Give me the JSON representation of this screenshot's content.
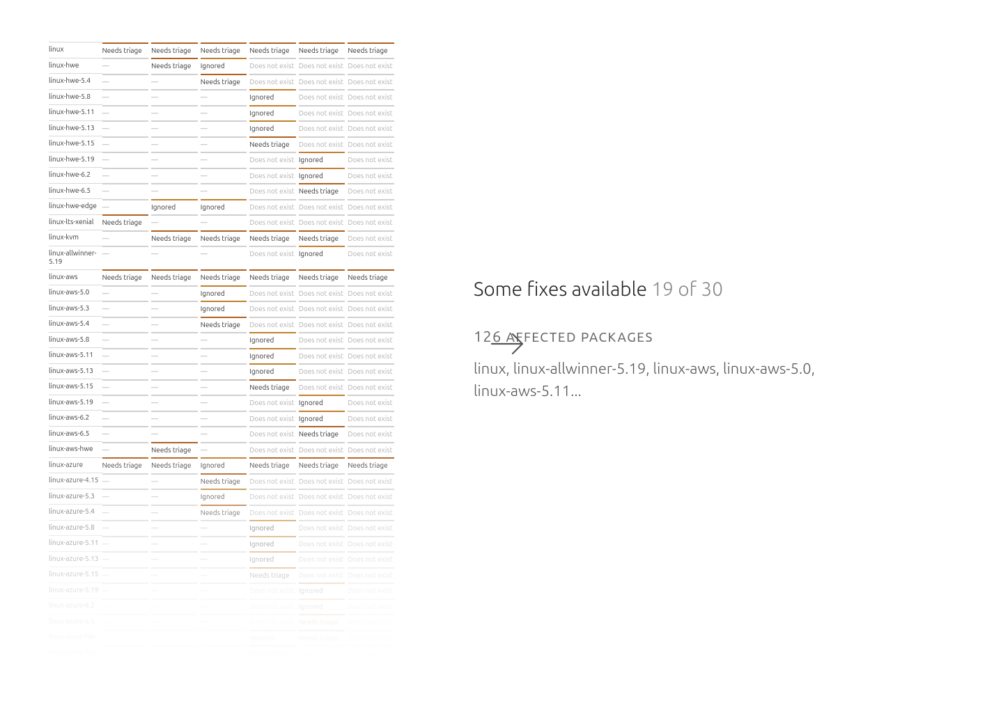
{
  "statuses": {
    "triage": "Needs triage",
    "ignored": "Ignored",
    "dne": "Does not exist",
    "dash": "—"
  },
  "table_rows": [
    {
      "pkg": "linux",
      "cells": [
        "triage",
        "triage",
        "triage",
        "triage",
        "triage",
        "triage"
      ]
    },
    {
      "pkg": "linux-hwe",
      "cells": [
        "dash",
        "triage",
        "ignored",
        "dne",
        "dne",
        "dne"
      ]
    },
    {
      "pkg": "linux-hwe-5.4",
      "cells": [
        "dash",
        "dash",
        "triage",
        "dne",
        "dne",
        "dne"
      ]
    },
    {
      "pkg": "linux-hwe-5.8",
      "cells": [
        "dash",
        "dash",
        "dash",
        "ignored",
        "dne",
        "dne"
      ]
    },
    {
      "pkg": "linux-hwe-5.11",
      "cells": [
        "dash",
        "dash",
        "dash",
        "ignored",
        "dne",
        "dne"
      ]
    },
    {
      "pkg": "linux-hwe-5.13",
      "cells": [
        "dash",
        "dash",
        "dash",
        "ignored",
        "dne",
        "dne"
      ]
    },
    {
      "pkg": "linux-hwe-5.15",
      "cells": [
        "dash",
        "dash",
        "dash",
        "triage",
        "dne",
        "dne"
      ]
    },
    {
      "pkg": "linux-hwe-5.19",
      "cells": [
        "dash",
        "dash",
        "dash",
        "dne",
        "ignored",
        "dne"
      ]
    },
    {
      "pkg": "linux-hwe-6.2",
      "cells": [
        "dash",
        "dash",
        "dash",
        "dne",
        "ignored",
        "dne"
      ]
    },
    {
      "pkg": "linux-hwe-6.5",
      "cells": [
        "dash",
        "dash",
        "dash",
        "dne",
        "triage",
        "dne"
      ]
    },
    {
      "pkg": "linux-hwe-edge",
      "cells": [
        "dash",
        "ignored",
        "ignored",
        "dne",
        "dne",
        "dne"
      ]
    },
    {
      "pkg": "linux-lts-xenial",
      "cells": [
        "triage",
        "dash",
        "dash",
        "dne",
        "dne",
        "dne"
      ]
    },
    {
      "pkg": "linux-kvm",
      "cells": [
        "dash",
        "triage",
        "triage",
        "triage",
        "triage",
        "dne"
      ]
    },
    {
      "pkg": "linux-allwinner-5.19",
      "cells": [
        "dash",
        "dash",
        "dash",
        "dne",
        "ignored",
        "dne"
      ]
    },
    {
      "pkg": "linux-aws",
      "cells": [
        "triage",
        "triage",
        "triage",
        "triage",
        "triage",
        "triage"
      ]
    },
    {
      "pkg": "linux-aws-5.0",
      "cells": [
        "dash",
        "dash",
        "ignored",
        "dne",
        "dne",
        "dne"
      ]
    },
    {
      "pkg": "linux-aws-5.3",
      "cells": [
        "dash",
        "dash",
        "ignored",
        "dne",
        "dne",
        "dne"
      ]
    },
    {
      "pkg": "linux-aws-5.4",
      "cells": [
        "dash",
        "dash",
        "triage",
        "dne",
        "dne",
        "dne"
      ]
    },
    {
      "pkg": "linux-aws-5.8",
      "cells": [
        "dash",
        "dash",
        "dash",
        "ignored",
        "dne",
        "dne"
      ]
    },
    {
      "pkg": "linux-aws-5.11",
      "cells": [
        "dash",
        "dash",
        "dash",
        "ignored",
        "dne",
        "dne"
      ]
    },
    {
      "pkg": "linux-aws-5.13",
      "cells": [
        "dash",
        "dash",
        "dash",
        "ignored",
        "dne",
        "dne"
      ]
    },
    {
      "pkg": "linux-aws-5.15",
      "cells": [
        "dash",
        "dash",
        "dash",
        "triage",
        "dne",
        "dne"
      ]
    },
    {
      "pkg": "linux-aws-5.19",
      "cells": [
        "dash",
        "dash",
        "dash",
        "dne",
        "ignored",
        "dne"
      ]
    },
    {
      "pkg": "linux-aws-6.2",
      "cells": [
        "dash",
        "dash",
        "dash",
        "dne",
        "ignored",
        "dne"
      ]
    },
    {
      "pkg": "linux-aws-6.5",
      "cells": [
        "dash",
        "dash",
        "dash",
        "dne",
        "triage",
        "dne"
      ]
    },
    {
      "pkg": "linux-aws-hwe",
      "cells": [
        "dash",
        "triage",
        "dash",
        "dne",
        "dne",
        "dne"
      ]
    },
    {
      "pkg": "linux-azure",
      "cells": [
        "triage",
        "triage",
        "ignored",
        "triage",
        "triage",
        "triage"
      ]
    },
    {
      "pkg": "linux-azure-4.15",
      "cells": [
        "dash",
        "dash",
        "triage",
        "dne",
        "dne",
        "dne"
      ]
    },
    {
      "pkg": "linux-azure-5.3",
      "cells": [
        "dash",
        "dash",
        "ignored",
        "dne",
        "dne",
        "dne"
      ]
    },
    {
      "pkg": "linux-azure-5.4",
      "cells": [
        "dash",
        "dash",
        "triage",
        "dne",
        "dne",
        "dne"
      ]
    },
    {
      "pkg": "linux-azure-5.8",
      "cells": [
        "dash",
        "dash",
        "dash",
        "ignored",
        "dne",
        "dne"
      ]
    },
    {
      "pkg": "linux-azure-5.11",
      "cells": [
        "dash",
        "dash",
        "dash",
        "ignored",
        "dne",
        "dne"
      ]
    },
    {
      "pkg": "linux-azure-5.13",
      "cells": [
        "dash",
        "dash",
        "dash",
        "ignored",
        "dne",
        "dne"
      ]
    },
    {
      "pkg": "linux-azure-5.15",
      "cells": [
        "dash",
        "dash",
        "dash",
        "triage",
        "dne",
        "dne"
      ]
    },
    {
      "pkg": "linux-azure-5.19",
      "cells": [
        "dash",
        "dash",
        "dash",
        "dne",
        "ignored",
        "dne"
      ]
    },
    {
      "pkg": "linux-azure-6.2",
      "cells": [
        "dash",
        "dash",
        "dash",
        "dne",
        "ignored",
        "dne"
      ]
    },
    {
      "pkg": "linux-azure-6.5",
      "cells": [
        "dash",
        "dash",
        "dash",
        "dne",
        "triage",
        "dne"
      ]
    },
    {
      "pkg": "linux-azure-fde",
      "cells": [
        "dash",
        "dash",
        "dash",
        "ignored",
        "triage",
        "dne"
      ]
    },
    {
      "pkg": "linux-azure-fde-5.15",
      "cells": [
        "dash",
        "dash",
        "dash",
        "triage",
        "dne",
        "dne"
      ]
    }
  ],
  "summary": {
    "fixes_label": "Some fixes available",
    "fixes_count": "19 of 30",
    "affected_count": "126",
    "affected_label": "affected packages",
    "packages_text": "linux, linux-allwinner-5.19, linux-aws, linux-aws-5.0, linux-aws-5.11..."
  }
}
